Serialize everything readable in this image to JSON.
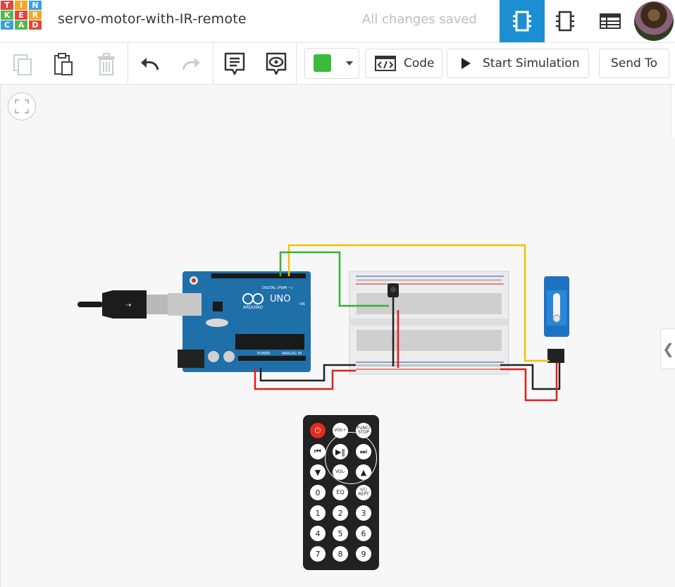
{
  "logo": {
    "letters": [
      "T",
      "I",
      "N",
      "K",
      "E",
      "R",
      "C",
      "A",
      "D"
    ]
  },
  "header": {
    "project_title": "servo-motor-with-IR-remote",
    "save_status": "All changes saved",
    "views": [
      "circuit-view-icon",
      "component-list-icon",
      "table-view-icon"
    ]
  },
  "toolbar": {
    "tools": [
      "copy-icon",
      "paste-icon",
      "delete-icon",
      "undo-icon",
      "redo-icon",
      "notes-icon",
      "notes-visibility-icon"
    ],
    "color_swatch": "#3cba3c",
    "code_label": "Code",
    "start_simulation_label": "Start Simulation",
    "send_to_label": "Send To"
  },
  "canvas": {
    "arduino": {
      "brand": "ARDUINO",
      "model": "UNO",
      "digital_label": "DIGITAL (PWM ~)",
      "power_label": "POWER",
      "analog_label": "ANALOG IN",
      "on_label": "ON"
    },
    "wire_colors": {
      "yellow": "#f2c200",
      "green": "#34b233",
      "red": "#e0201b",
      "black": "#222222"
    }
  },
  "remote": {
    "buttons": [
      {
        "label": "⏻"
      },
      {
        "label": "VOL+"
      },
      {
        "label": "FUNC/ STOP"
      },
      {
        "label": "⏮"
      },
      {
        "label": "▶‖"
      },
      {
        "label": "⏭"
      },
      {
        "label": "▼"
      },
      {
        "label": "VOL-"
      },
      {
        "label": "▲"
      },
      {
        "label": "0"
      },
      {
        "label": "EQ"
      },
      {
        "label": "ST/ REPT"
      },
      {
        "label": "1"
      },
      {
        "label": "2"
      },
      {
        "label": "3"
      },
      {
        "label": "4"
      },
      {
        "label": "5"
      },
      {
        "label": "6"
      },
      {
        "label": "7"
      },
      {
        "label": "8"
      },
      {
        "label": "9"
      }
    ]
  }
}
